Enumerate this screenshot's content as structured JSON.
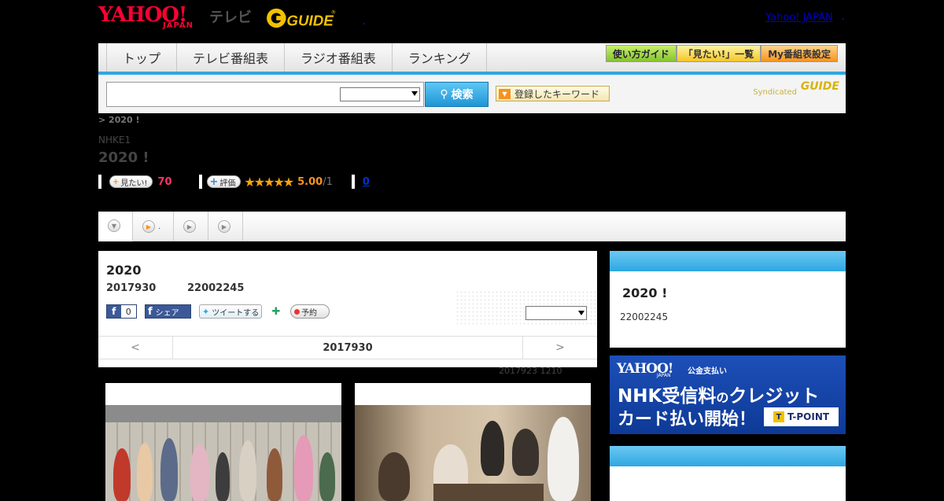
{
  "header": {
    "yahoo_logo": "YAHOO!",
    "japan_logo": "JAPAN",
    "tv_label": "テレビ",
    "gguide_logo": "G GUIDE",
    "top_link": "Yahoo! JAPAN",
    "dot1": ".",
    "dot2": "."
  },
  "nav": {
    "tabs": [
      "トップ",
      "テレビ番組表",
      "ラジオ番組表",
      "ランキング"
    ],
    "buttons": [
      "使い方ガイド",
      "「見たい!」一覧",
      "My番組表設定"
    ]
  },
  "search": {
    "input_value": "",
    "select_value": "",
    "button_label": "検索",
    "keyword_button": "登録したキーワード",
    "syndicated": "Syndicated",
    "syndicated_logo": "GUIDE"
  },
  "program": {
    "breadcrumb": "> 2020 !",
    "channel": "NHKE1",
    "title": "2020 !",
    "want_label": "見たい!",
    "want_count": "70",
    "rate_label": "評価",
    "stars": "★★★★★",
    "rating": "5.00",
    "rating_sub": "/1",
    "comment_count": "0"
  },
  "tabs": {
    "tab2_label": "."
  },
  "main": {
    "title": "2020",
    "date": "2017930",
    "time": "22002245",
    "fb_like_count": "0",
    "fb_share": "シェア",
    "tweet": "ツイートする",
    "reserve": "予約",
    "pager_prev": "<",
    "pager_date": "2017930",
    "pager_next": ">",
    "updated": "2017923  1210"
  },
  "sidebar": {
    "title": "2020 !",
    "time": "22002245"
  },
  "banner": {
    "yahoo": "YAHOO!",
    "japan": "JAPAN",
    "pay": "公金支払い",
    "line1a": "NHK受信料",
    "line1b": "の",
    "line1c": "クレジット",
    "line2": "カード払い開始！",
    "tpoint": "T-POINT"
  }
}
